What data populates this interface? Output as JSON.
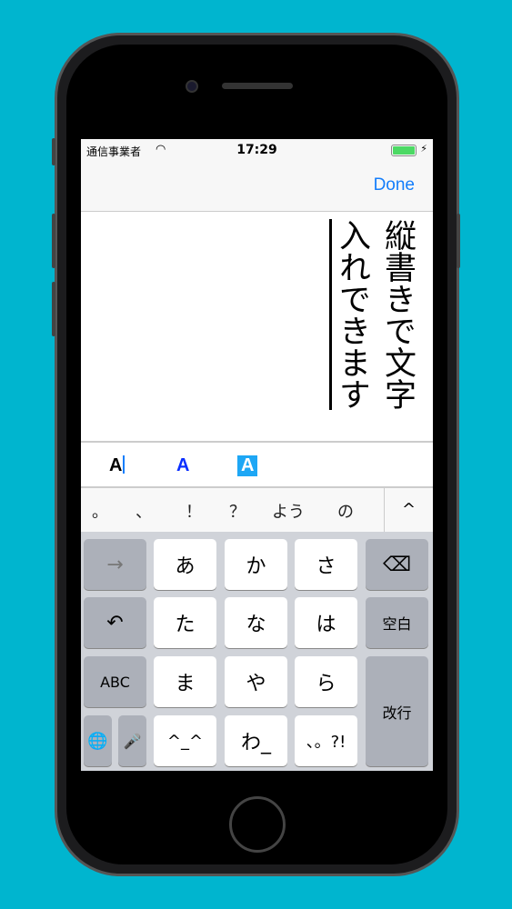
{
  "status": {
    "carrier": "通信事業者",
    "wifi_icon": "wifi-icon",
    "time": "17:29",
    "battery_icon": "battery-charging-icon",
    "bolt": "⚡"
  },
  "nav": {
    "done_label": "Done"
  },
  "editor": {
    "lines": [
      "縦書きで文字",
      "入れできます"
    ]
  },
  "format_bar": {
    "items": [
      "A",
      "A",
      "A"
    ],
    "colors": {
      "plain": "#000000",
      "colored": "#0a2fff",
      "highlight": "#1ea7f5"
    }
  },
  "candidates": {
    "items": [
      "。",
      "、",
      "！",
      "？",
      "よう",
      "の"
    ],
    "expand": "^"
  },
  "keyboard": {
    "arrow": "→",
    "backspace": "⌫",
    "undo": "↶",
    "space": "空白",
    "abc": "ABC",
    "enter": "改行",
    "globe": "🌐",
    "mic": "🎤",
    "kana": [
      "あ",
      "か",
      "さ",
      "た",
      "な",
      "は",
      "ま",
      "や",
      "ら",
      "^_^",
      "わ_",
      "、。?!"
    ]
  },
  "accent": "#147efb"
}
